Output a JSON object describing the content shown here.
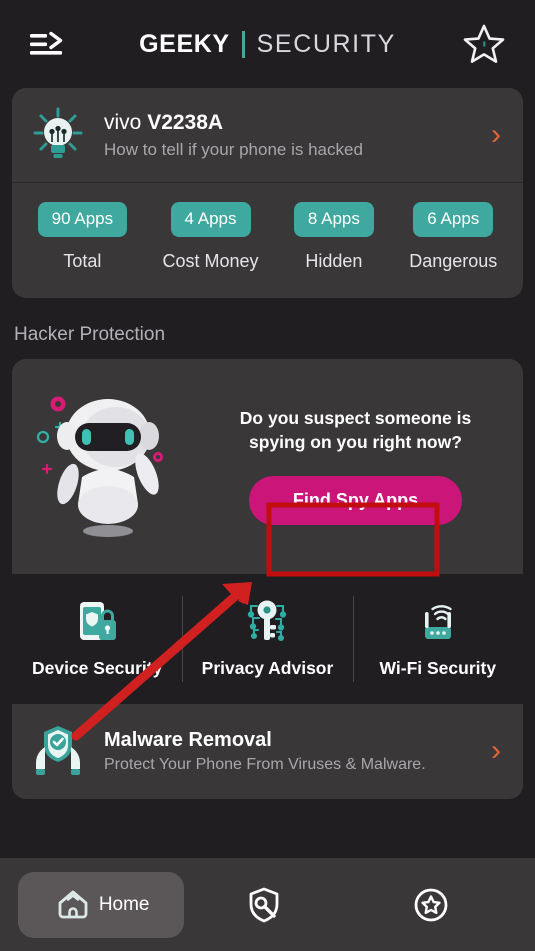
{
  "app": {
    "brand_primary": "GEEKY",
    "brand_secondary": "SECURITY",
    "menu_icon": "hamburger-arrow-icon",
    "favorite_icon": "star-outline-icon",
    "accent_teal": "#3fa9a0",
    "accent_pink": "#cb1579",
    "accent_orange": "#e2653a",
    "page_bg": "#211e22",
    "card_bg": "#3a3739"
  },
  "device_card": {
    "icon": "lightbulb-idea-icon",
    "title_light": "vivo ",
    "title_bold": "V2238A",
    "subtitle": "How to tell if your phone is hacked",
    "chevron": "›"
  },
  "stats": [
    {
      "badge": "90 Apps",
      "label": "Total"
    },
    {
      "badge": "4 Apps",
      "label": "Cost Money"
    },
    {
      "badge": "8 Apps",
      "label": "Hidden"
    },
    {
      "badge": "6 Apps",
      "label": "Dangerous"
    }
  ],
  "section": {
    "hacker_protection_title": "Hacker Protection"
  },
  "hacker_protection": {
    "illustration": "robot-mascot-icon",
    "question_line1": "Do you suspect someone is",
    "question_line2": "spying on you right now?",
    "cta_label": "Find Spy Apps"
  },
  "features": [
    {
      "icon": "phone-shield-lock-icon",
      "label": "Device Security"
    },
    {
      "icon": "key-circuit-icon",
      "label": "Privacy Advisor"
    },
    {
      "icon": "wifi-router-icon",
      "label": "Wi-Fi Security"
    }
  ],
  "malware_card": {
    "icon": "hands-shield-check-icon",
    "title": "Malware Removal",
    "subtitle": "Protect Your Phone From Viruses & Malware.",
    "chevron": "›"
  },
  "bottom_nav": [
    {
      "icon": "home-icon",
      "label": "Home",
      "active": true
    },
    {
      "icon": "shield-wrench-icon",
      "label": "",
      "active": false
    },
    {
      "icon": "star-circle-icon",
      "label": "",
      "active": false
    }
  ],
  "annotation": {
    "highlight_color": "#c10d0d",
    "arrow_color": "#d12020",
    "target": "Find Spy Apps"
  }
}
